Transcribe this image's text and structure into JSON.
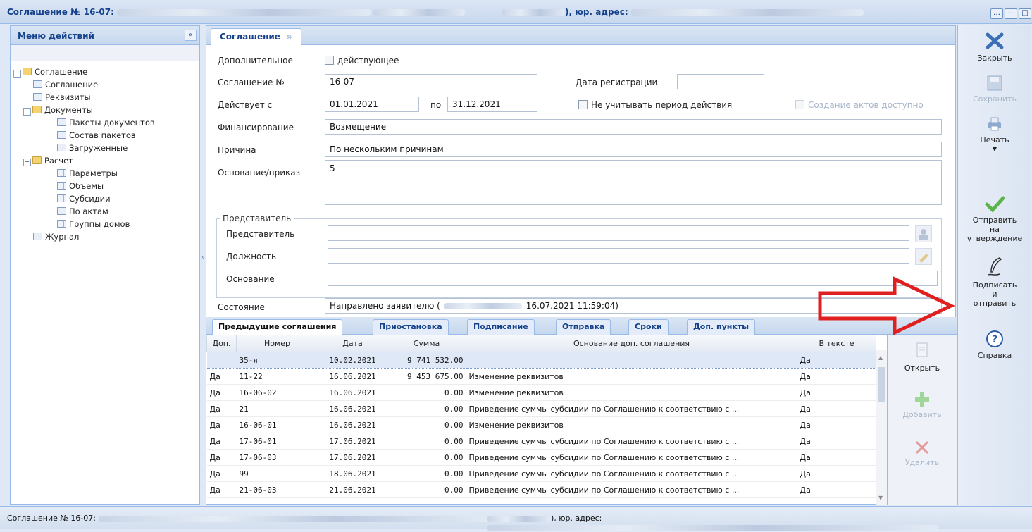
{
  "window": {
    "title": "Соглашение № 16-07:",
    "title_address": "), юр. адрес:",
    "controls": [
      "…",
      "—",
      "□"
    ]
  },
  "left_panel": {
    "title": "Меню действий",
    "collapse": "«",
    "tree": [
      {
        "label": "Соглашение",
        "type": "folder"
      },
      {
        "label": "Соглашение",
        "type": "leaf"
      },
      {
        "label": "Реквизиты",
        "type": "leaf"
      },
      {
        "label": "Документы",
        "type": "folder"
      },
      {
        "label": "Пакеты документов",
        "type": "leaf"
      },
      {
        "label": "Состав пакетов",
        "type": "leaf"
      },
      {
        "label": "Загруженные",
        "type": "leaf"
      },
      {
        "label": "Расчет",
        "type": "folder"
      },
      {
        "label": "Параметры",
        "type": "grid"
      },
      {
        "label": "Объемы",
        "type": "grid"
      },
      {
        "label": "Субсидии",
        "type": "grid"
      },
      {
        "label": "По актам",
        "type": "leaf"
      },
      {
        "label": "Группы домов",
        "type": "grid"
      },
      {
        "label": "Журнал",
        "type": "leaf"
      }
    ]
  },
  "main": {
    "tab_label": "Соглашение",
    "form": {
      "additional_label": "Дополнительное",
      "active_label": "действующее",
      "agreement_no_label": "Соглашение №",
      "agreement_no": "16-07",
      "reg_date_label": "Дата регистрации",
      "reg_date": "",
      "valid_from_label": "Действует с",
      "valid_from": "01.01.2021",
      "to_label": "по",
      "valid_to": "31.12.2021",
      "ignore_period_label": "Не учитывать период действия",
      "acts_available_label": "Создание актов доступно",
      "financing_label": "Финансирование",
      "financing": "Возмещение",
      "reason_label": "Причина",
      "reason": "По нескольким причинам",
      "basis_label": "Основание/приказ",
      "basis": "5",
      "rep_group_label": "Представитель",
      "rep_label": "Представитель",
      "rep_value": "",
      "position_label": "Должность",
      "position_value": "",
      "rep_basis_label": "Основание",
      "rep_basis_value": "",
      "state_label": "Состояние",
      "state_value": "Направлено заявителю (",
      "state_date": "16.07.2021 11:59:04)"
    },
    "subtabs": [
      "Предыдущие соглашения",
      "Приостановка",
      "Подписание",
      "Отправка",
      "Сроки",
      "Доп. пункты"
    ],
    "table": {
      "headers": [
        "Доп.",
        "Номер",
        "Дата",
        "Сумма",
        "Основание доп. соглашения",
        "В тексте"
      ],
      "rows": [
        [
          "",
          "35-я",
          "10.02.2021",
          "9 741 532.00",
          "",
          "Да"
        ],
        [
          "Да",
          "11-22",
          "16.06.2021",
          "9 453 675.00",
          "Изменение реквизитов",
          "Да"
        ],
        [
          "Да",
          "16-06-02",
          "16.06.2021",
          "0.00",
          "Изменение реквизитов",
          "Да"
        ],
        [
          "Да",
          "21",
          "16.06.2021",
          "0.00",
          "Приведение суммы субсидии по Соглашению к соответствию с ...",
          "Да"
        ],
        [
          "Да",
          "16-06-01",
          "16.06.2021",
          "0.00",
          "Изменение реквизитов",
          "Да"
        ],
        [
          "Да",
          "17-06-01",
          "17.06.2021",
          "0.00",
          "Приведение суммы субсидии по Соглашению к соответствию с ...",
          "Да"
        ],
        [
          "Да",
          "17-06-03",
          "17.06.2021",
          "0.00",
          "Приведение суммы субсидии по Соглашению к соответствию с ...",
          "Да"
        ],
        [
          "Да",
          "99",
          "18.06.2021",
          "0.00",
          "Приведение суммы субсидии по Соглашению к соответствию с ...",
          "Да"
        ],
        [
          "Да",
          "21-06-03",
          "21.06.2021",
          "0.00",
          "Приведение суммы субсидии по Соглашению к соответствию с ...",
          "Да"
        ]
      ]
    },
    "grid_buttons": {
      "open": "Открыть",
      "add": "Добавить",
      "delete": "Удалить"
    }
  },
  "toolbar": {
    "close": "Закрыть",
    "save": "Сохранить",
    "print": "Печать",
    "send_line1": "Отправить",
    "send_line2": "на",
    "send_line3": "утверждение",
    "sign_line1": "Подписать",
    "sign_line2": "и",
    "sign_line3": "отправить",
    "help": "Справка"
  },
  "statusbar": {
    "text": "Соглашение № 16-07:",
    "address": "), юр. адрес:"
  },
  "colors": {
    "accent": "#15428b",
    "annotation_arrow": "#e02020"
  }
}
